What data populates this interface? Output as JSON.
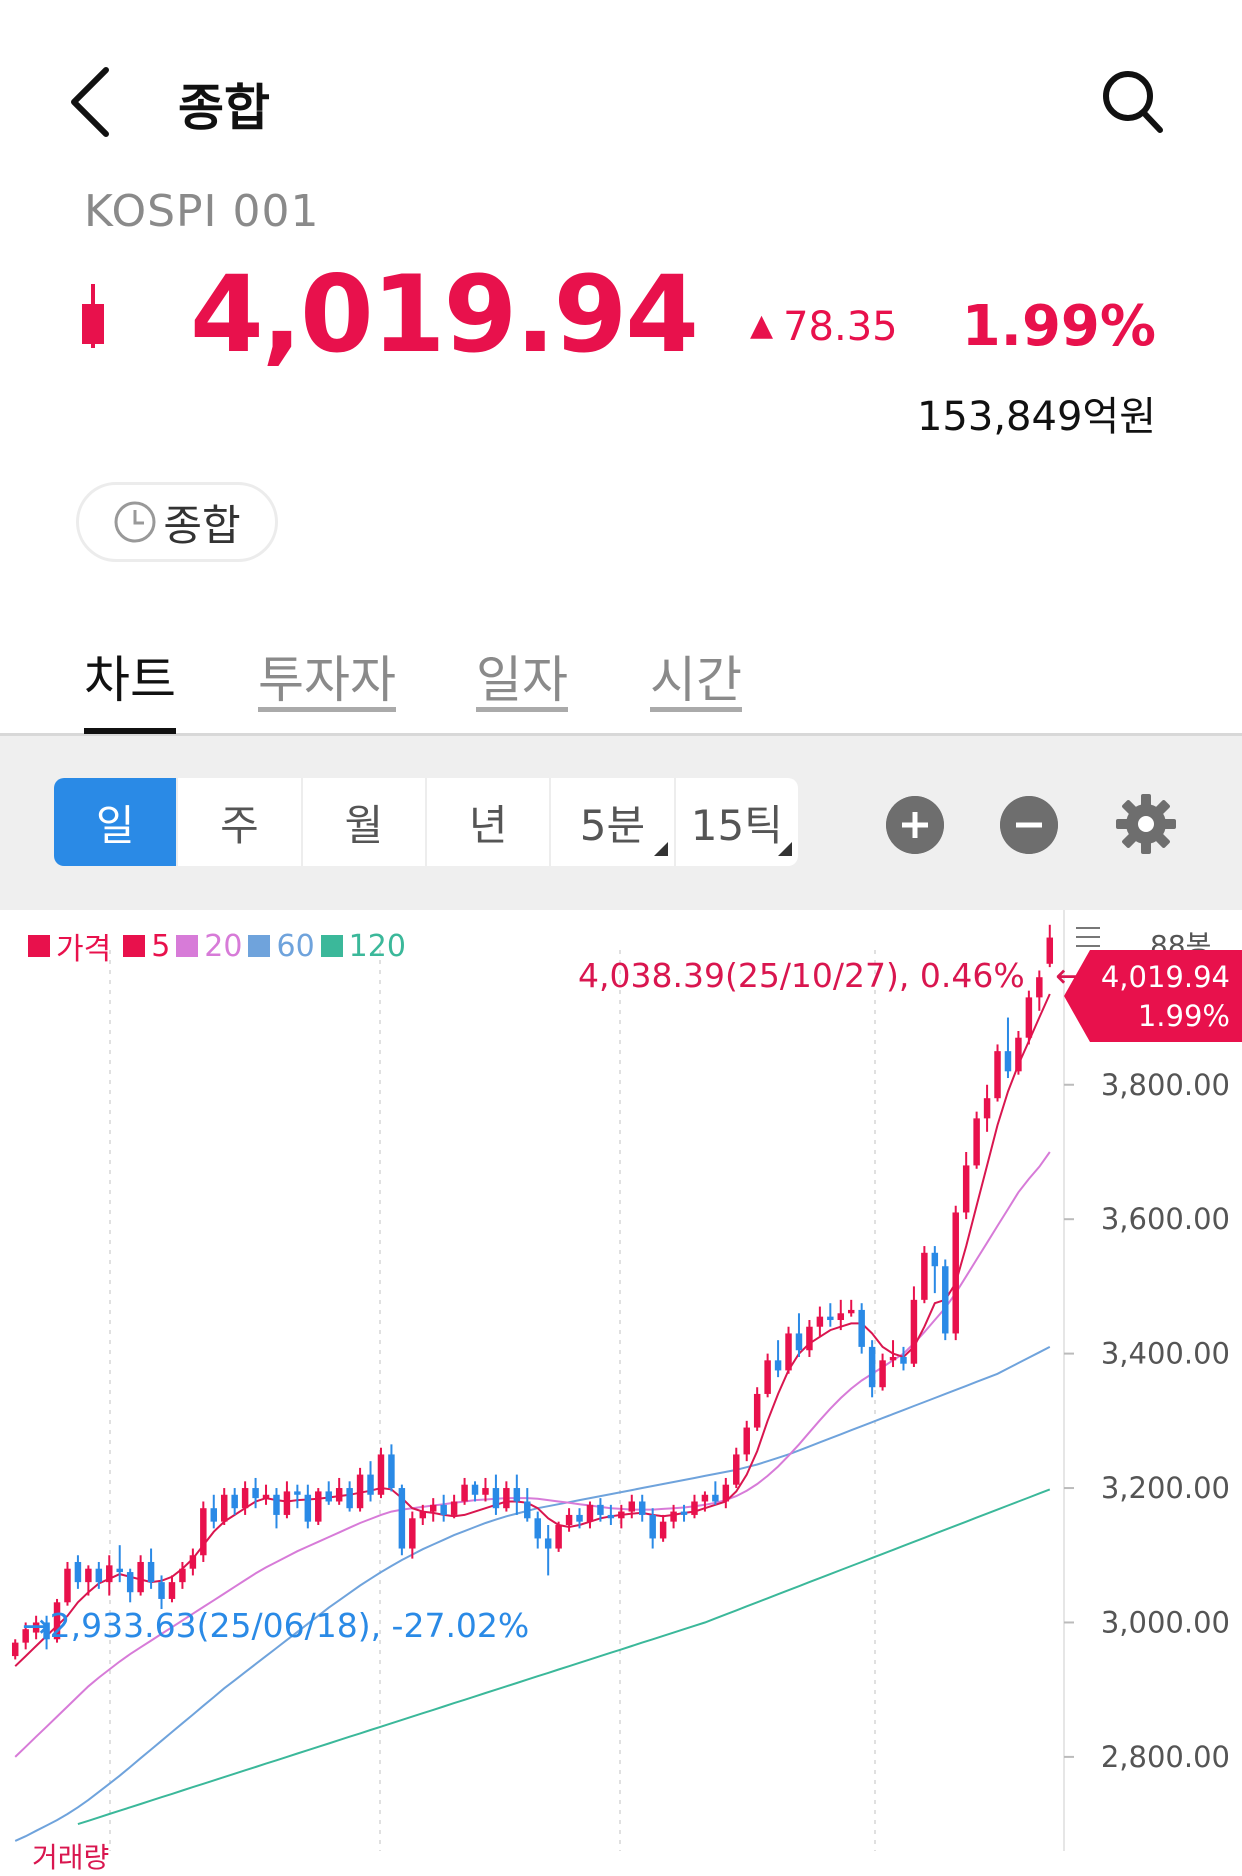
{
  "header": {
    "title": "종합",
    "code": "KOSPI 001"
  },
  "quote": {
    "price": "4,019.94",
    "change": "78.35",
    "change_arrow": "▲",
    "change_pct": "1.99%",
    "volume": "153,849억원",
    "up_color": "#e8114c"
  },
  "session": {
    "label": "종합"
  },
  "tabs": [
    {
      "label": "차트",
      "active": true
    },
    {
      "label": "투자자",
      "active": false
    },
    {
      "label": "일자",
      "active": false
    },
    {
      "label": "시간",
      "active": false
    }
  ],
  "periods": [
    {
      "label": "일",
      "selected": true
    },
    {
      "label": "주"
    },
    {
      "label": "월"
    },
    {
      "label": "년"
    },
    {
      "label": "5분",
      "dropdown": true
    },
    {
      "label": "15틱",
      "dropdown": true
    }
  ],
  "chart_data": {
    "type": "candlestick",
    "legend": [
      {
        "label": "가격",
        "color": "#e8114c"
      },
      {
        "label": "5",
        "color": "#e8114c"
      },
      {
        "label": "20",
        "color": "#d77bd8"
      },
      {
        "label": "60",
        "color": "#6fa3dc"
      },
      {
        "label": "120",
        "color": "#3bb89a"
      }
    ],
    "bars_label": "88봉",
    "y_ticks": [
      "3,800.00",
      "3,600.00",
      "3,400.00",
      "3,200.00",
      "3,000.00",
      "2,800.00"
    ],
    "y_tick_values": [
      3800,
      3600,
      3400,
      3200,
      3000,
      2800
    ],
    "ylim": [
      2660,
      4060
    ],
    "high_annotation": "4,038.39(25/10/27), 0.46%",
    "low_annotation": "2,933.63(25/06/18), -27.02%",
    "last_price": "4,019.94",
    "last_pct": "1.99%",
    "volume_label": "거래량",
    "colors": {
      "up": "#e8114c",
      "down": "#2a8ae6",
      "ma5": "#d9164f",
      "ma20": "#d77bd8",
      "ma60": "#6fa3dc",
      "ma120": "#3bb89a"
    },
    "candles": [
      [
        2950,
        2975,
        2945,
        2970
      ],
      [
        2970,
        3000,
        2960,
        2990
      ],
      [
        2985,
        3010,
        2975,
        3000
      ],
      [
        3000,
        3010,
        2960,
        2975
      ],
      [
        2975,
        3035,
        2970,
        3030
      ],
      [
        3030,
        3090,
        3025,
        3080
      ],
      [
        3090,
        3100,
        3050,
        3060
      ],
      [
        3060,
        3085,
        3040,
        3080
      ],
      [
        3080,
        3090,
        3050,
        3060
      ],
      [
        3060,
        3100,
        3040,
        3085
      ],
      [
        3080,
        3115,
        3060,
        3075
      ],
      [
        3075,
        3080,
        3030,
        3045
      ],
      [
        3045,
        3100,
        3040,
        3090
      ],
      [
        3090,
        3110,
        3050,
        3060
      ],
      [
        3060,
        3070,
        3020,
        3035
      ],
      [
        3035,
        3070,
        3030,
        3060
      ],
      [
        3060,
        3090,
        3050,
        3080
      ],
      [
        3080,
        3110,
        3070,
        3100
      ],
      [
        3100,
        3180,
        3090,
        3170
      ],
      [
        3170,
        3190,
        3140,
        3150
      ],
      [
        3150,
        3200,
        3145,
        3190
      ],
      [
        3190,
        3200,
        3160,
        3170
      ],
      [
        3170,
        3210,
        3160,
        3200
      ],
      [
        3200,
        3215,
        3170,
        3185
      ],
      [
        3185,
        3205,
        3175,
        3190
      ],
      [
        3190,
        3200,
        3140,
        3160
      ],
      [
        3160,
        3210,
        3155,
        3195
      ],
      [
        3195,
        3205,
        3170,
        3190
      ],
      [
        3190,
        3205,
        3140,
        3150
      ],
      [
        3150,
        3200,
        3145,
        3195
      ],
      [
        3195,
        3210,
        3175,
        3180
      ],
      [
        3180,
        3215,
        3175,
        3200
      ],
      [
        3200,
        3210,
        3165,
        3170
      ],
      [
        3170,
        3230,
        3165,
        3220
      ],
      [
        3220,
        3240,
        3180,
        3190
      ],
      [
        3190,
        3260,
        3185,
        3250
      ],
      [
        3250,
        3265,
        3195,
        3200
      ],
      [
        3200,
        3205,
        3100,
        3110
      ],
      [
        3110,
        3165,
        3095,
        3155
      ],
      [
        3155,
        3175,
        3145,
        3165
      ],
      [
        3165,
        3185,
        3150,
        3175
      ],
      [
        3175,
        3190,
        3150,
        3160
      ],
      [
        3160,
        3190,
        3155,
        3180
      ],
      [
        3180,
        3215,
        3175,
        3205
      ],
      [
        3205,
        3210,
        3180,
        3190
      ],
      [
        3190,
        3215,
        3180,
        3200
      ],
      [
        3200,
        3220,
        3160,
        3170
      ],
      [
        3170,
        3210,
        3165,
        3200
      ],
      [
        3200,
        3220,
        3160,
        3180
      ],
      [
        3180,
        3200,
        3150,
        3155
      ],
      [
        3155,
        3165,
        3110,
        3125
      ],
      [
        3125,
        3145,
        3070,
        3110
      ],
      [
        3110,
        3150,
        3105,
        3145
      ],
      [
        3145,
        3170,
        3135,
        3160
      ],
      [
        3160,
        3170,
        3140,
        3150
      ],
      [
        3150,
        3180,
        3140,
        3175
      ],
      [
        3175,
        3185,
        3150,
        3160
      ],
      [
        3160,
        3175,
        3145,
        3155
      ],
      [
        3155,
        3175,
        3140,
        3165
      ],
      [
        3165,
        3190,
        3155,
        3180
      ],
      [
        3180,
        3190,
        3150,
        3160
      ],
      [
        3160,
        3170,
        3110,
        3125
      ],
      [
        3125,
        3160,
        3120,
        3150
      ],
      [
        3150,
        3175,
        3140,
        3165
      ],
      [
        3165,
        3175,
        3150,
        3160
      ],
      [
        3160,
        3190,
        3155,
        3180
      ],
      [
        3180,
        3195,
        3165,
        3190
      ],
      [
        3190,
        3210,
        3175,
        3180
      ],
      [
        3180,
        3215,
        3170,
        3205
      ],
      [
        3205,
        3260,
        3200,
        3250
      ],
      [
        3250,
        3300,
        3240,
        3290
      ],
      [
        3290,
        3350,
        3285,
        3340
      ],
      [
        3340,
        3400,
        3335,
        3390
      ],
      [
        3390,
        3420,
        3365,
        3375
      ],
      [
        3375,
        3440,
        3370,
        3430
      ],
      [
        3430,
        3460,
        3395,
        3405
      ],
      [
        3405,
        3450,
        3395,
        3440
      ],
      [
        3440,
        3470,
        3425,
        3455
      ],
      [
        3455,
        3475,
        3440,
        3450
      ],
      [
        3450,
        3480,
        3435,
        3460
      ],
      [
        3460,
        3480,
        3455,
        3465
      ],
      [
        3465,
        3475,
        3400,
        3410
      ],
      [
        3410,
        3420,
        3335,
        3350
      ],
      [
        3350,
        3400,
        3345,
        3390
      ],
      [
        3390,
        3420,
        3380,
        3395
      ],
      [
        3395,
        3410,
        3375,
        3385
      ],
      [
        3385,
        3500,
        3380,
        3480
      ],
      [
        3480,
        3560,
        3475,
        3550
      ],
      [
        3550,
        3560,
        3490,
        3530
      ],
      [
        3530,
        3540,
        3420,
        3430
      ],
      [
        3430,
        3620,
        3420,
        3610
      ],
      [
        3610,
        3700,
        3600,
        3680
      ],
      [
        3680,
        3760,
        3675,
        3750
      ],
      [
        3750,
        3800,
        3730,
        3780
      ],
      [
        3780,
        3860,
        3775,
        3850
      ],
      [
        3850,
        3900,
        3810,
        3820
      ],
      [
        3820,
        3880,
        3815,
        3870
      ],
      [
        3870,
        3940,
        3860,
        3930
      ],
      [
        3930,
        3970,
        3910,
        3960
      ],
      [
        3980,
        4038,
        3975,
        4019
      ]
    ],
    "ma5": [
      2935,
      2950,
      2965,
      2980,
      2995,
      3010,
      3030,
      3045,
      3058,
      3065,
      3072,
      3068,
      3064,
      3060,
      3062,
      3068,
      3080,
      3095,
      3115,
      3135,
      3150,
      3160,
      3170,
      3180,
      3185,
      3182,
      3180,
      3182,
      3183,
      3184,
      3186,
      3188,
      3190,
      3193,
      3196,
      3200,
      3198,
      3185,
      3170,
      3165,
      3163,
      3160,
      3158,
      3160,
      3165,
      3170,
      3175,
      3180,
      3180,
      3178,
      3170,
      3155,
      3145,
      3142,
      3145,
      3150,
      3155,
      3158,
      3160,
      3162,
      3163,
      3160,
      3158,
      3160,
      3163,
      3165,
      3170,
      3175,
      3180,
      3195,
      3220,
      3255,
      3300,
      3340,
      3375,
      3400,
      3415,
      3425,
      3435,
      3440,
      3445,
      3445,
      3430,
      3410,
      3400,
      3395,
      3410,
      3440,
      3475,
      3480,
      3505,
      3560,
      3620,
      3680,
      3740,
      3790,
      3830,
      3865,
      3900,
      3935
    ],
    "ma20": [
      2800,
      2815,
      2830,
      2845,
      2860,
      2875,
      2890,
      2905,
      2918,
      2930,
      2942,
      2953,
      2963,
      2973,
      2983,
      2993,
      3003,
      3013,
      3023,
      3033,
      3043,
      3053,
      3063,
      3073,
      3082,
      3090,
      3098,
      3106,
      3113,
      3120,
      3127,
      3134,
      3141,
      3148,
      3154,
      3160,
      3165,
      3168,
      3170,
      3172,
      3174,
      3176,
      3178,
      3180,
      3182,
      3183,
      3184,
      3185,
      3185,
      3185,
      3184,
      3182,
      3180,
      3178,
      3176,
      3174,
      3172,
      3170,
      3169,
      3168,
      3168,
      3168,
      3169,
      3170,
      3171,
      3173,
      3175,
      3178,
      3182,
      3188,
      3196,
      3206,
      3218,
      3232,
      3248,
      3265,
      3283,
      3301,
      3318,
      3334,
      3348,
      3360,
      3370,
      3380,
      3390,
      3400,
      3415,
      3432,
      3450,
      3468,
      3490,
      3515,
      3540,
      3565,
      3590,
      3615,
      3640,
      3660,
      3678,
      3700
    ],
    "ma60": [
      2675,
      2682,
      2690,
      2698,
      2706,
      2715,
      2725,
      2736,
      2748,
      2760,
      2772,
      2785,
      2798,
      2811,
      2824,
      2837,
      2850,
      2863,
      2876,
      2889,
      2902,
      2914,
      2926,
      2938,
      2950,
      2962,
      2974,
      2986,
      2998,
      3010,
      3022,
      3033,
      3044,
      3055,
      3065,
      3075,
      3084,
      3093,
      3101,
      3109,
      3116,
      3123,
      3130,
      3136,
      3142,
      3148,
      3153,
      3158,
      3162,
      3166,
      3170,
      3173,
      3176,
      3179,
      3182,
      3185,
      3188,
      3191,
      3194,
      3197,
      3200,
      3203,
      3206,
      3209,
      3212,
      3215,
      3218,
      3221,
      3224,
      3227,
      3231,
      3235,
      3240,
      3245,
      3250,
      3256,
      3262,
      3268,
      3274,
      3280,
      3286,
      3292,
      3298,
      3304,
      3310,
      3316,
      3322,
      3328,
      3334,
      3340,
      3346,
      3352,
      3358,
      3364,
      3370,
      3378,
      3386,
      3394,
      3402,
      3410
    ],
    "ma120_start": 6,
    "ma120": [
      2700,
      2705,
      2710,
      2715,
      2720,
      2725,
      2730,
      2735,
      2740,
      2745,
      2750,
      2755,
      2760,
      2765,
      2770,
      2775,
      2780,
      2785,
      2790,
      2795,
      2800,
      2805,
      2810,
      2815,
      2820,
      2825,
      2830,
      2835,
      2840,
      2845,
      2850,
      2855,
      2860,
      2865,
      2870,
      2875,
      2880,
      2885,
      2890,
      2895,
      2900,
      2905,
      2910,
      2915,
      2920,
      2925,
      2930,
      2935,
      2940,
      2945,
      2950,
      2955,
      2960,
      2965,
      2970,
      2975,
      2980,
      2985,
      2990,
      2995,
      3000,
      3006,
      3012,
      3018,
      3024,
      3030,
      3036,
      3042,
      3048,
      3054,
      3060,
      3066,
      3072,
      3078,
      3084,
      3090,
      3096,
      3102,
      3108,
      3114,
      3120,
      3126,
      3132,
      3138,
      3144,
      3150,
      3156,
      3162,
      3168,
      3174,
      3180,
      3186,
      3192,
      3198
    ]
  }
}
